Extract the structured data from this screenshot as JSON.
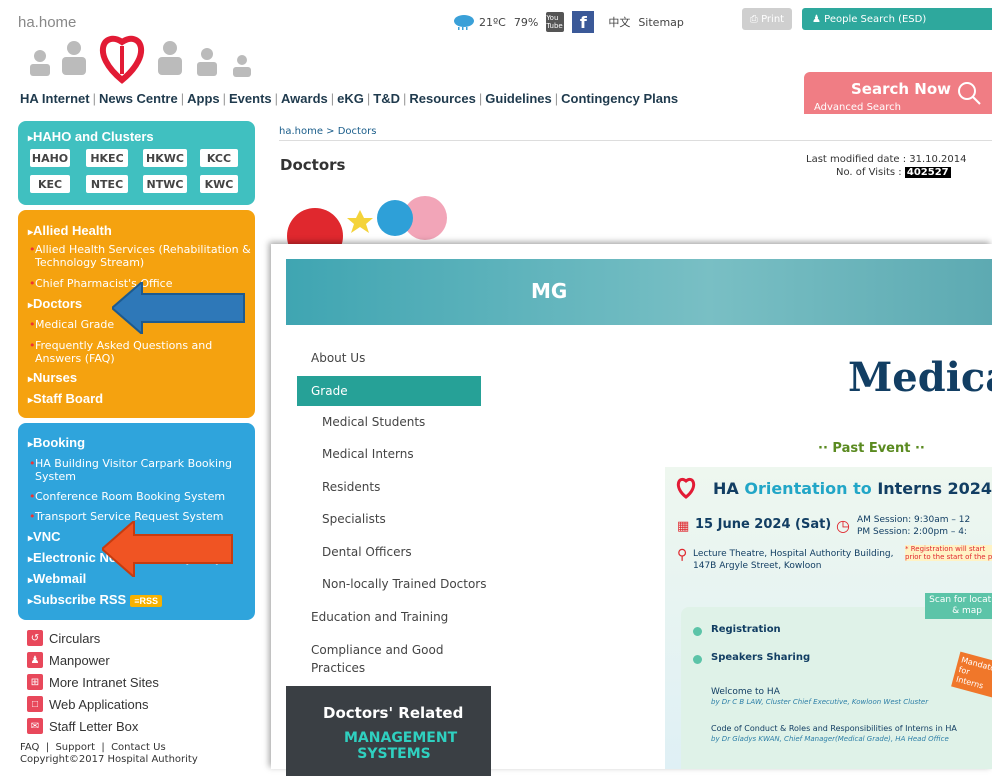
{
  "header": {
    "site_logo_text": "ha.home",
    "weather": {
      "temperature": "21ºC",
      "humidity": "79%"
    },
    "youtube_label": "You Tube",
    "facebook_label": "f",
    "chinese_link": "中文",
    "sitemap_link": "Sitemap",
    "print_button": "Print",
    "people_search_button": "People Search (ESD)",
    "search_now": "Search Now",
    "advanced_search": "Advanced Search"
  },
  "nav": {
    "items": [
      "HA Internet",
      "News Centre",
      "Apps",
      "Events",
      "Awards",
      "eKG",
      "T&D",
      "Resources",
      "Guidelines",
      "Contingency Plans"
    ]
  },
  "sidebar": {
    "clusters_heading": "HAHO and Clusters",
    "clusters": [
      "HAHO",
      "HKEC",
      "HKWC",
      "KCC",
      "KEC",
      "NTEC",
      "NTWC",
      "KWC"
    ],
    "orange": {
      "allied_health": "Allied Health",
      "allied_sub": [
        "Allied Health Services (Rehabilitation & Technology Stream)",
        "Chief Pharmacist's Office"
      ],
      "doctors": "Doctors",
      "doctors_sub": [
        "Medical Grade",
        "Frequently Asked Questions and Answers (FAQ)"
      ],
      "nurses": "Nurses",
      "staff_board": "Staff Board"
    },
    "blue": {
      "booking": "Booking",
      "booking_sub": [
        "HA Building Visitor Carpark Booking System",
        "Conference Room Booking System",
        "Transport Service Request System"
      ],
      "vnc": "VNC",
      "enb": "Electronic Notice Board (ENB)",
      "webmail": "Webmail",
      "subscribe_rss": "Subscribe RSS",
      "rss_badge": "RSS"
    },
    "links": [
      "Circulars",
      "Manpower",
      "More Intranet Sites",
      "Web Applications",
      "Staff Letter Box"
    ],
    "footer_links": "FAQ  |  Support  |  Contact Us",
    "copyright": "Copyright©2017 Hospital Authority"
  },
  "main": {
    "breadcrumb": "ha.home > Doctors",
    "title": "Doctors",
    "last_modified": "Last modified date : 31.10.2014",
    "visits_label": "No. of Visits :",
    "visits_count": "402527"
  },
  "overlay": {
    "logo": "MG",
    "nav": [
      "About Us",
      "Grade",
      "Medical Students",
      "Medical Interns",
      "Residents",
      "Specialists",
      "Dental Officers",
      "Non-locally Trained Doctors",
      "Education and Training",
      "Compliance and Good Practices"
    ],
    "related_title": "Doctors' Related",
    "related_sub": "MANAGEMENT SYSTEMS",
    "heading": "Medica",
    "past_event": "·· Past Event ··",
    "poster": {
      "title_prefix": "HA ",
      "title_orientation": "Orientation to ",
      "title_rest": "Interns 2024/",
      "date": "15 June 2024 (Sat)",
      "am_session": "AM Session: 9:30am – 12",
      "pm_session": "PM Session: 2:00pm – 4:",
      "registration_note": "* Registration will start prior to the start of the p",
      "venue_line1": "Lecture Theatre, Hospital Authority Building,",
      "venue_line2": "147B Argyle Street, Kowloon",
      "scan": "Scan for location & map",
      "registration": "Registration",
      "speakers": "Speakers Sharing",
      "mandatory": "Mandatory for Interns",
      "welcome": "Welcome to HA",
      "welcome_by": "by Dr C B LAW, Cluster Chief Executive, Kowloon West Cluster",
      "code": "Code of Conduct & Roles and Responsibilities of Interns in HA",
      "code_by": "by Dr Gladys KWAN, Chief Manager(Medical Grade), HA Head Office"
    }
  },
  "colors": {
    "teal": "#40c0c0",
    "orange": "#f5a20f",
    "blue": "#2fa4dc",
    "search_pink": "#f07d84",
    "grade_green": "#26a197"
  }
}
